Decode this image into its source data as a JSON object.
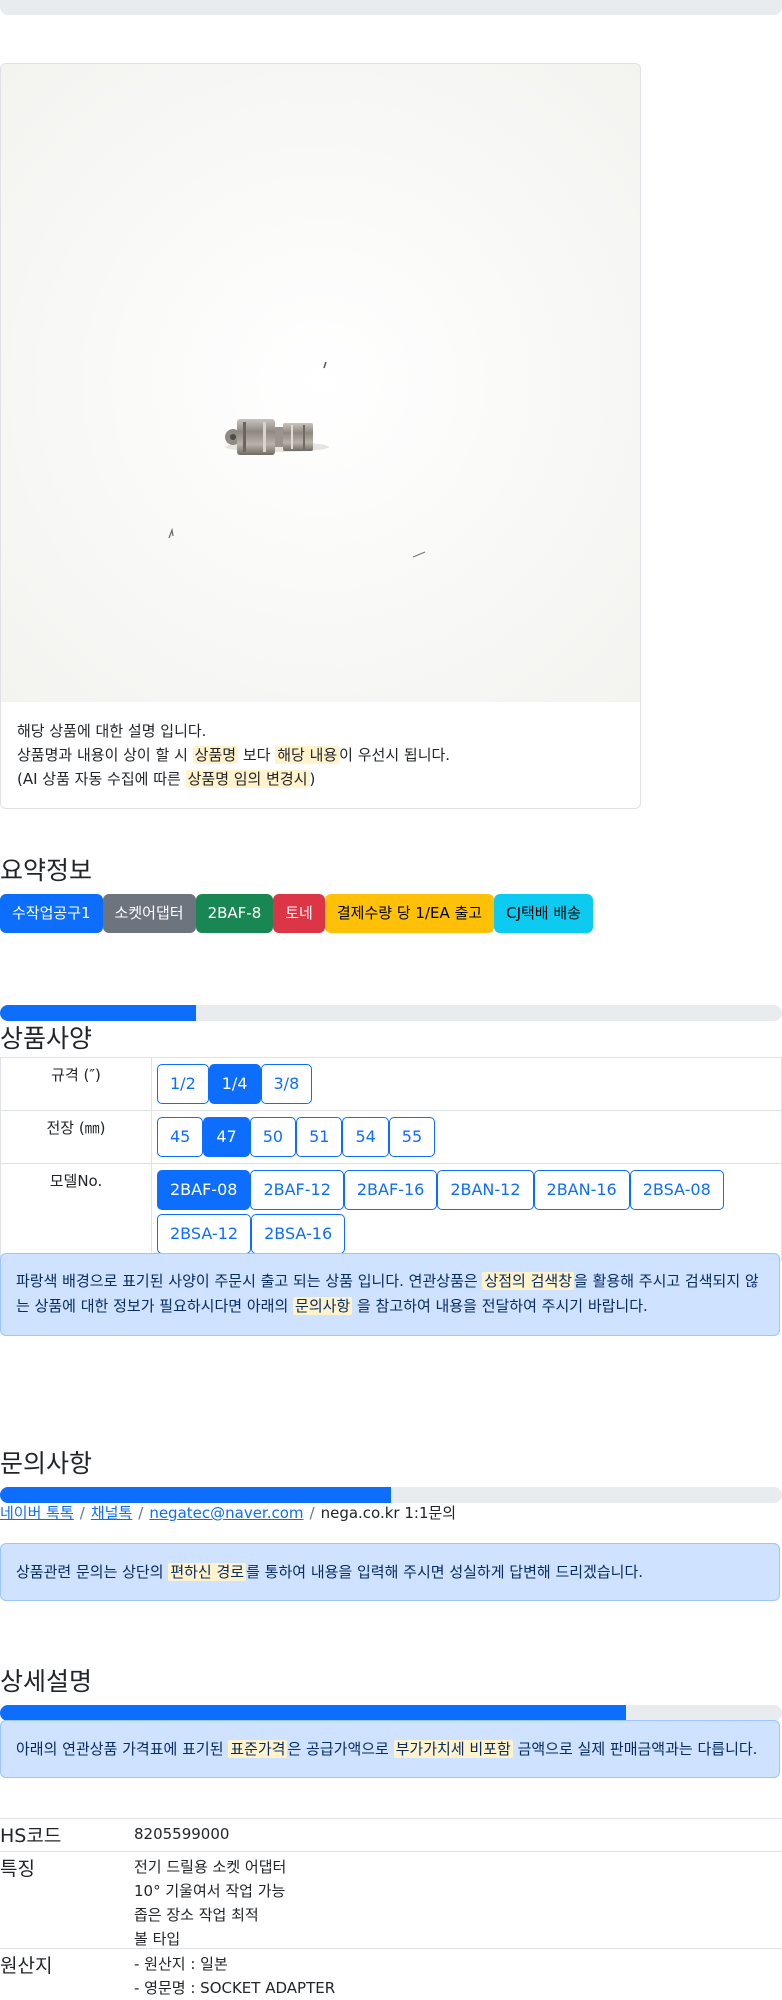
{
  "card": {
    "desc_line1": "해당 상품에 대한 설명 입니다.",
    "desc_line2_pre": "상품명과 내용이 상이 할 시 ",
    "desc_line2_hl1": "상품명",
    "desc_line2_mid": " 보다 ",
    "desc_line2_hl2": "해당 내용",
    "desc_line2_post": "이 우선시 됩니다.",
    "desc_line3_pre": "(AI 상품 자동 수집에 따른 ",
    "desc_line3_hl": "상품명 임의 변경시",
    "desc_line3_post": ")"
  },
  "summary": {
    "title": "요약정보",
    "badges": [
      {
        "label": "수작업공구1",
        "color": "#0d6efd"
      },
      {
        "label": "소켓어댑터",
        "color": "#6c757d"
      },
      {
        "label": "2BAF-8",
        "color": "#198754"
      },
      {
        "label": "토네",
        "color": "#dc3545"
      },
      {
        "label": "결제수량 당 1/EA 출고",
        "color": "#ffc107"
      },
      {
        "label": "CJ택배 배송",
        "color": "#0dcaf0"
      }
    ]
  },
  "spec": {
    "title": "상품사양",
    "progress": 0.25,
    "rows": [
      {
        "label": "규격 (″)",
        "options": [
          "1/2",
          "1/4",
          "3/8"
        ],
        "selected": "1/4"
      },
      {
        "label": "전장 (㎜)",
        "options": [
          "45",
          "47",
          "50",
          "51",
          "54",
          "55"
        ],
        "selected": "47"
      },
      {
        "label": "모델No.",
        "options": [
          "2BAF-08",
          "2BAF-12",
          "2BAF-16",
          "2BAN-12",
          "2BAN-16",
          "2BSA-08",
          "2BSA-12",
          "2BSA-16"
        ],
        "selected": "2BAF-08"
      }
    ],
    "notice_pre": "파랑색 배경으로 표기된 사양이 주문시 출고 되는 상품 입니다. 연관상품은 ",
    "notice_hl1": "상점의 검색창",
    "notice_mid": "을 활용해 주시고 검색되지 않는 상품에 대한 정보가 필요하시다면 아래의 ",
    "notice_hl2": "문의사항",
    "notice_post": " 을 참고하여 내용을 전달하여 주시기 바랍니다."
  },
  "inquiry": {
    "title": "문의사항",
    "progress": 0.5,
    "link1": "네이버 톡톡",
    "link2": "채널톡",
    "link3": "negatec@naver.com",
    "text4": "nega.co.kr 1:1문의",
    "notice_pre": "상품관련 문의는 상단의 ",
    "notice_hl": "편하신 경로",
    "notice_post": "를 통하여 내용을 입력해 주시면 성실하게 답변해 드리겠습니다."
  },
  "detail": {
    "title": "상세설명",
    "progress": 0.8,
    "notice_pre": "아래의 연관상품 가격표에 표기된 ",
    "notice_hl1": "표준가격",
    "notice_mid": "은 공급가액으로 ",
    "notice_hl2": "부가가치세 비포함",
    "notice_post": " 금액으로 실제 판매금액과는 다릅니다.",
    "hs_label": "HS코드",
    "hs_value": "8205599000",
    "feature_label": "특징",
    "features": [
      "전기 드릴용 소켓 어댑터",
      "10° 기울여서 작업 가능",
      "좁은 장소 작업 최적",
      "볼 타입"
    ],
    "origin_label": "원산지",
    "origin": [
      "- 원산지 : 일본",
      "- 영문명 : SOCKET ADAPTER"
    ]
  }
}
